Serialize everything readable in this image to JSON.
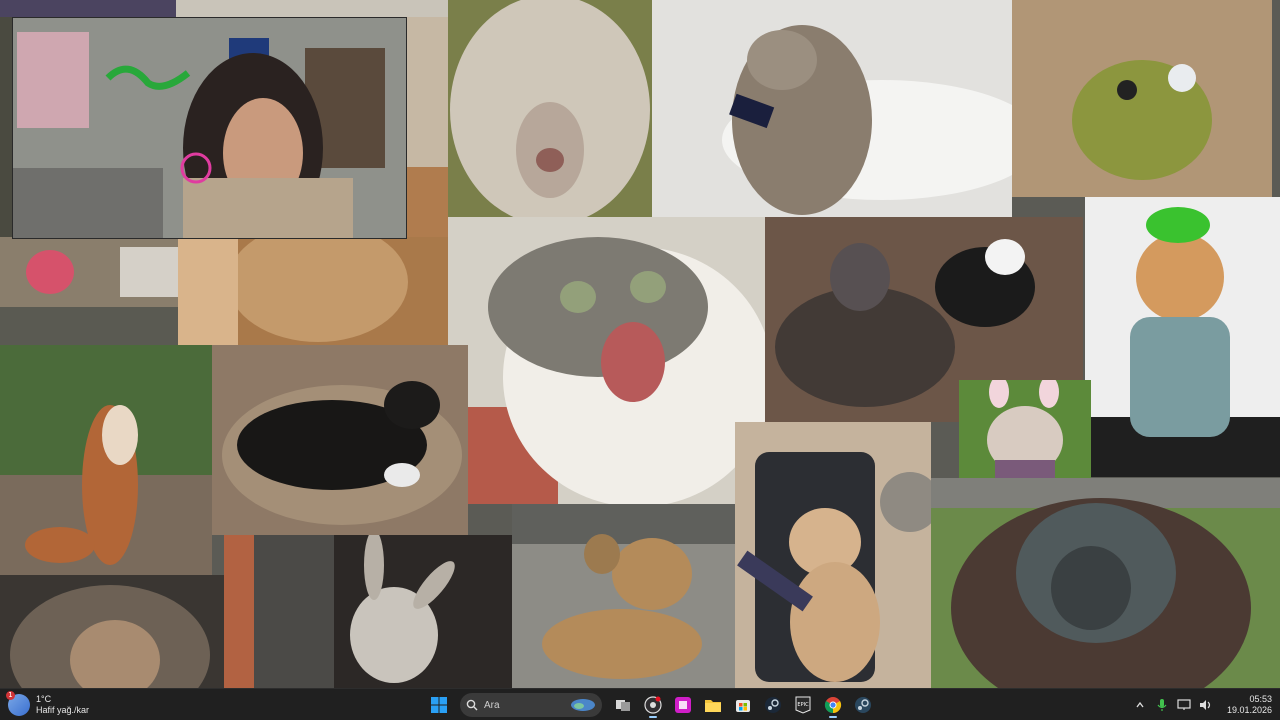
{
  "desktop": {
    "wallpaper": "animal meme collage",
    "tiles": [
      {
        "name": "fluffy-sheep",
        "colors": [
          "#9a958c",
          "#d9d3c8"
        ]
      },
      {
        "name": "cat-on-toilet",
        "colors": [
          "#c9c9c6",
          "#8a7f72"
        ]
      },
      {
        "name": "frog-in-sand",
        "colors": [
          "#b49a7c",
          "#7e8a3a"
        ]
      },
      {
        "name": "shocked-cat",
        "colors": [
          "#d0ccc3",
          "#7a7670"
        ]
      },
      {
        "name": "dogs-fighting",
        "colors": [
          "#6e5c4f",
          "#2f2b2a"
        ]
      },
      {
        "name": "cat-in-green-hat",
        "colors": [
          "#e6e6e6",
          "#7d9aa0"
        ]
      },
      {
        "name": "squirrel-arms-up",
        "colors": [
          "#4f6b3c",
          "#b86c3a"
        ]
      },
      {
        "name": "black-dog-with-controller",
        "colors": [
          "#8f7760",
          "#1c1a18"
        ]
      },
      {
        "name": "dog-with-bunny-ears",
        "colors": [
          "#5f8c3f",
          "#d7c4b5"
        ]
      },
      {
        "name": "gamer-cat-in-chair",
        "colors": [
          "#b9a892",
          "#2f3137"
        ]
      },
      {
        "name": "orangutan",
        "colors": [
          "#6b8a4a",
          "#4a3e38"
        ]
      },
      {
        "name": "monkey-squinting",
        "colors": [
          "#5b544c",
          "#a58c6e"
        ]
      },
      {
        "name": "donkey-in-stable",
        "colors": [
          "#3a3532",
          "#cfc8c0"
        ]
      },
      {
        "name": "dog-on-street",
        "colors": [
          "#8b8b86",
          "#b08a57"
        ]
      }
    ],
    "webcam": {
      "label": "webcam overlay"
    }
  },
  "taskbar": {
    "weather": {
      "temp": "1°C",
      "desc": "Hafif yağ./kar",
      "badge": "1"
    },
    "search": {
      "placeholder": "Ara"
    },
    "apps": [
      {
        "name": "start-button",
        "icon": "windows-logo-icon"
      },
      {
        "name": "search-box",
        "icon": "search-icon"
      },
      {
        "name": "task-view-button",
        "icon": "task-view-icon"
      },
      {
        "name": "obs-button",
        "icon": "obs-icon"
      },
      {
        "name": "app-pink-button",
        "icon": "app-icon"
      },
      {
        "name": "file-explorer-button",
        "icon": "folder-icon"
      },
      {
        "name": "store-button",
        "icon": "store-icon"
      },
      {
        "name": "steam-button",
        "icon": "steam-icon"
      },
      {
        "name": "epic-button",
        "icon": "epic-games-icon"
      },
      {
        "name": "chrome-button",
        "icon": "chrome-icon"
      },
      {
        "name": "steam-2-button",
        "icon": "steam-icon"
      }
    ],
    "tray": {
      "time": "05:53",
      "date": "19.01.2026"
    }
  },
  "colors": {
    "taskbar": "#202020",
    "accent": "#0078d4"
  }
}
